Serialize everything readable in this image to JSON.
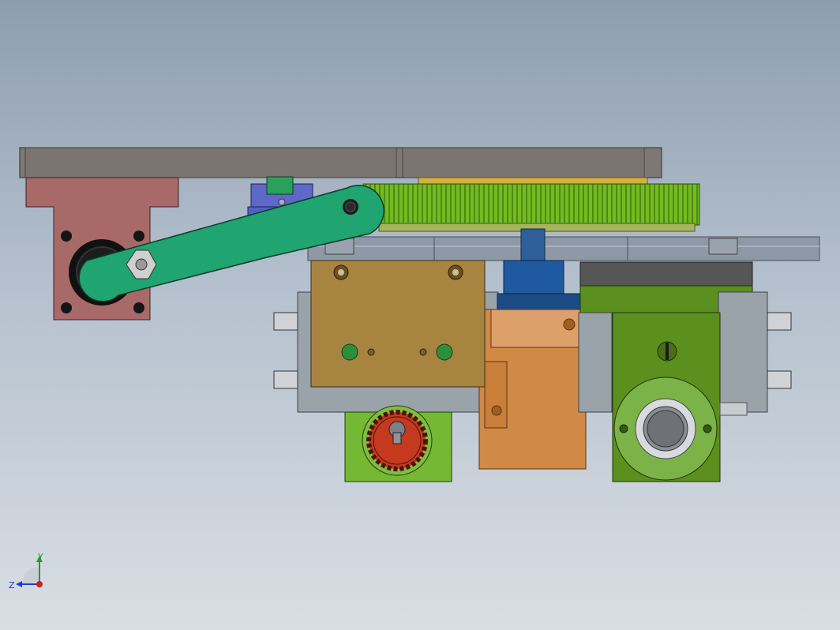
{
  "view": {
    "background_top": "#8e9db1",
    "background_bottom": "#d9dee4"
  },
  "colors": {
    "plate": "#7f7a76",
    "bracket": "#a96a6a",
    "link_arm": "#1fa371",
    "gear_large": "#70b81e",
    "gear_small": "#c53a1e",
    "block_tan": "#a88441",
    "housing_green": "#5b8f1e",
    "motor_copper": "#d08a45",
    "coupling_blue": "#1e5a9e",
    "rail": "#8d98a6",
    "plate_steel": "#9aa2ab",
    "slider_blue": "#5864c8"
  },
  "triad": {
    "x_label": "",
    "y_label": "Y",
    "z_label": "Z"
  }
}
